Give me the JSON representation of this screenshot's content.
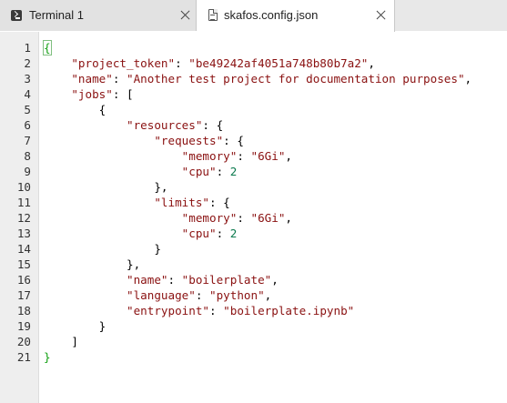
{
  "tabs": [
    {
      "label": "Terminal 1",
      "icon": "terminal-icon",
      "active": false
    },
    {
      "label": "skafos.config.json",
      "icon": "file-icon",
      "active": true
    }
  ],
  "editor": {
    "line_numbers": [
      "1",
      "2",
      "3",
      "4",
      "5",
      "6",
      "7",
      "8",
      "9",
      "10",
      "11",
      "12",
      "13",
      "14",
      "15",
      "16",
      "17",
      "18",
      "19",
      "20",
      "21"
    ],
    "lines": [
      [
        {
          "t": "{",
          "c": "bracket-hl cursor-bracket"
        }
      ],
      [
        {
          "t": "    "
        },
        {
          "t": "\"project_token\"",
          "c": "k"
        },
        {
          "t": ": "
        },
        {
          "t": "\"be49242af4051a748b80b7a2\"",
          "c": "s"
        },
        {
          "t": ","
        }
      ],
      [
        {
          "t": "    "
        },
        {
          "t": "\"name\"",
          "c": "k"
        },
        {
          "t": ": "
        },
        {
          "t": "\"Another test project for documentation purposes\"",
          "c": "s"
        },
        {
          "t": ","
        }
      ],
      [
        {
          "t": "    "
        },
        {
          "t": "\"jobs\"",
          "c": "k"
        },
        {
          "t": ": ["
        }
      ],
      [
        {
          "t": "        {"
        }
      ],
      [
        {
          "t": "            "
        },
        {
          "t": "\"resources\"",
          "c": "k"
        },
        {
          "t": ": {"
        }
      ],
      [
        {
          "t": "                "
        },
        {
          "t": "\"requests\"",
          "c": "k"
        },
        {
          "t": ": {"
        }
      ],
      [
        {
          "t": "                    "
        },
        {
          "t": "\"memory\"",
          "c": "k"
        },
        {
          "t": ": "
        },
        {
          "t": "\"6Gi\"",
          "c": "s"
        },
        {
          "t": ","
        }
      ],
      [
        {
          "t": "                    "
        },
        {
          "t": "\"cpu\"",
          "c": "k"
        },
        {
          "t": ": "
        },
        {
          "t": "2",
          "c": "n"
        }
      ],
      [
        {
          "t": "                },"
        }
      ],
      [
        {
          "t": "                "
        },
        {
          "t": "\"limits\"",
          "c": "k"
        },
        {
          "t": ": {"
        }
      ],
      [
        {
          "t": "                    "
        },
        {
          "t": "\"memory\"",
          "c": "k"
        },
        {
          "t": ": "
        },
        {
          "t": "\"6Gi\"",
          "c": "s"
        },
        {
          "t": ","
        }
      ],
      [
        {
          "t": "                    "
        },
        {
          "t": "\"cpu\"",
          "c": "k"
        },
        {
          "t": ": "
        },
        {
          "t": "2",
          "c": "n"
        }
      ],
      [
        {
          "t": "                }"
        }
      ],
      [
        {
          "t": "            },"
        }
      ],
      [
        {
          "t": "            "
        },
        {
          "t": "\"name\"",
          "c": "k"
        },
        {
          "t": ": "
        },
        {
          "t": "\"boilerplate\"",
          "c": "s"
        },
        {
          "t": ","
        }
      ],
      [
        {
          "t": "            "
        },
        {
          "t": "\"language\"",
          "c": "k"
        },
        {
          "t": ": "
        },
        {
          "t": "\"python\"",
          "c": "s"
        },
        {
          "t": ","
        }
      ],
      [
        {
          "t": "            "
        },
        {
          "t": "\"entrypoint\"",
          "c": "k"
        },
        {
          "t": ": "
        },
        {
          "t": "\"boilerplate.ipynb\"",
          "c": "s"
        }
      ],
      [
        {
          "t": "        }"
        }
      ],
      [
        {
          "t": "    ]"
        }
      ],
      [
        {
          "t": "}",
          "c": "bracket-hl"
        }
      ]
    ]
  },
  "colors": {
    "key": "#8a1111",
    "string": "#8a1111",
    "number": "#0b7a4e",
    "bracket_match": "#12a012",
    "gutter_bg": "#eeeeee",
    "tabbar_bg": "#e8e8e8"
  }
}
